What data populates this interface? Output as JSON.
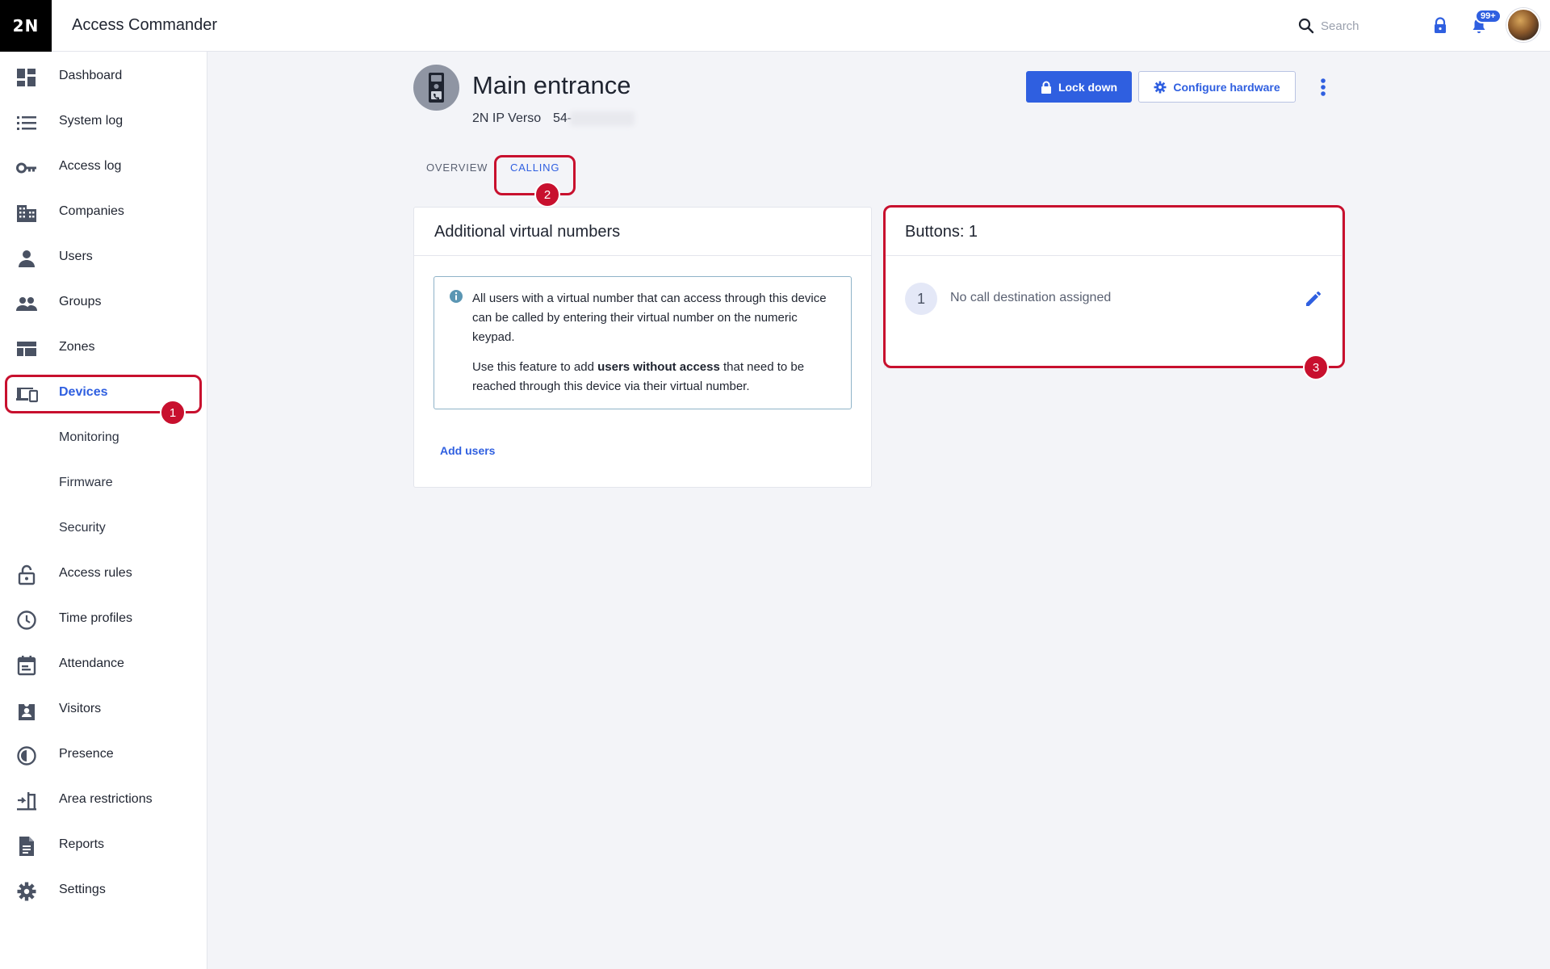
{
  "app": {
    "logo": "2N",
    "title": "Access Commander"
  },
  "topbar": {
    "search_placeholder": "Search",
    "notifications_badge": "99+"
  },
  "sidebar": {
    "items": [
      {
        "label": "Dashboard",
        "icon": "dashboard-icon"
      },
      {
        "label": "System log",
        "icon": "list-icon"
      },
      {
        "label": "Access log",
        "icon": "key-icon"
      },
      {
        "label": "Companies",
        "icon": "building-icon"
      },
      {
        "label": "Users",
        "icon": "person-icon"
      },
      {
        "label": "Groups",
        "icon": "people-icon"
      },
      {
        "label": "Zones",
        "icon": "zones-icon"
      },
      {
        "label": "Devices",
        "icon": "devices-icon",
        "active": true
      },
      {
        "label": "Monitoring"
      },
      {
        "label": "Firmware"
      },
      {
        "label": "Security"
      },
      {
        "label": "Access rules",
        "icon": "lock-icon"
      },
      {
        "label": "Time profiles",
        "icon": "clock-icon"
      },
      {
        "label": "Attendance",
        "icon": "calendar-icon"
      },
      {
        "label": "Visitors",
        "icon": "badge-icon"
      },
      {
        "label": "Presence",
        "icon": "presence-icon"
      },
      {
        "label": "Area restrictions",
        "icon": "area-icon"
      },
      {
        "label": "Reports",
        "icon": "report-icon"
      },
      {
        "label": "Settings",
        "icon": "gear-icon"
      }
    ]
  },
  "device": {
    "name": "Main entrance",
    "model": "2N IP Verso",
    "serial_prefix": "54-"
  },
  "actions": {
    "lock_down": "Lock down",
    "configure_hardware": "Configure hardware"
  },
  "tabs": [
    {
      "label": "OVERVIEW"
    },
    {
      "label": "CALLING",
      "active": true
    }
  ],
  "virtual_numbers": {
    "title": "Additional virtual numbers",
    "info_p1": "All users with a virtual number that can access through this device can be called by entering their virtual number on the numeric keypad.",
    "info_p2_before": "Use this feature to add ",
    "info_p2_bold": "users without access",
    "info_p2_after": " that need to be reached through this device via their virtual number.",
    "add_users": "Add users"
  },
  "buttons_card": {
    "title": "Buttons: 1",
    "rows": [
      {
        "number": "1",
        "text": "No call destination assigned"
      }
    ]
  },
  "annotations": {
    "markers": [
      "1",
      "2",
      "3"
    ],
    "color": "#c8102e"
  },
  "colors": {
    "accent": "#2f5fe0",
    "annotation": "#c8102e"
  }
}
